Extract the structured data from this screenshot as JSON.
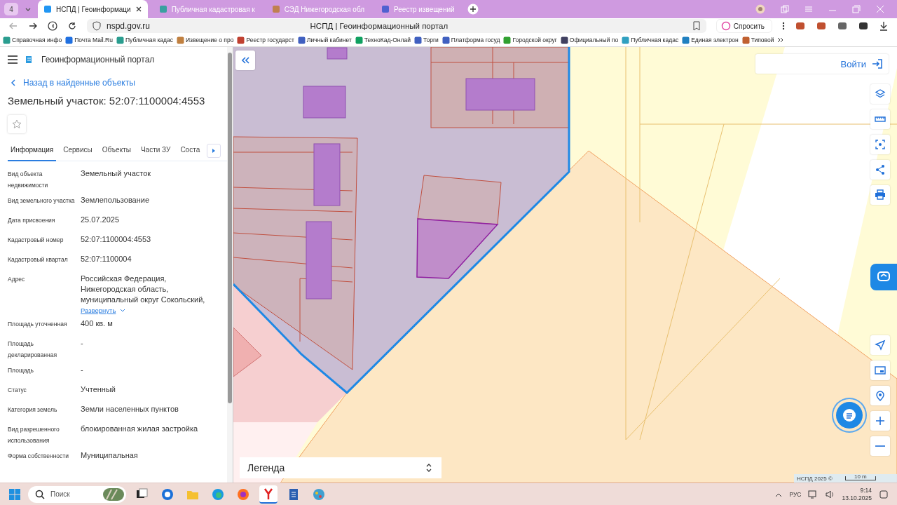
{
  "browser": {
    "tab_count": "4",
    "tabs": [
      {
        "label": "НСПД | Геоинформаци",
        "selected": true
      },
      {
        "label": "Публичная кадастровая к",
        "selected": false
      },
      {
        "label": "СЭД Нижегородская обл",
        "selected": false
      },
      {
        "label": "Реестр извещений",
        "selected": false
      }
    ],
    "address": "nspd.gov.ru",
    "page_title": "НСПД | Геоинформационный портал",
    "ask_button": "Спросить",
    "bookmarks": [
      "Справочная инфо",
      "Почта Mail.Ru",
      "Публичная кадас",
      "Извещение о про",
      "Реестр государст",
      "Личный кабинет",
      "ТехноКад-Онлай",
      "Торги",
      "Платформа госуд",
      "Городской округ",
      "Официальный по",
      "Публичная кадас",
      "Единая электрон",
      "Типовой"
    ]
  },
  "panel": {
    "portal_title": "Геоинформационный портал",
    "back_link": "Назад в найденные объекты",
    "heading": "Земельный участок: 52:07:1100004:4553",
    "tabs": [
      {
        "label": "Информация",
        "selected": true
      },
      {
        "label": "Сервисы",
        "selected": false
      },
      {
        "label": "Объекты",
        "selected": false
      },
      {
        "label": "Части ЗУ",
        "selected": false
      },
      {
        "label": "Соста",
        "selected": false
      }
    ],
    "fields": [
      {
        "label": "Вид объекта недвижимости",
        "value": "Земельный участок"
      },
      {
        "label": "Вид земельного участка",
        "value": "Землепользование"
      },
      {
        "label": "Дата присвоения",
        "value": "25.07.2025"
      },
      {
        "label": "Кадастровый номер",
        "value": "52:07:1100004:4553"
      },
      {
        "label": "Кадастровый квартал",
        "value": "52:07:1100004"
      },
      {
        "label": "Адрес",
        "value": "Российская Федерация, Нижегородская область, муниципальный округ Сокольский,",
        "expand_link": "Развернуть"
      },
      {
        "label": "Площадь уточненная",
        "value": "400 кв. м"
      },
      {
        "label": "Площадь декларированная",
        "value": "-"
      },
      {
        "label": "Площадь",
        "value": "-"
      },
      {
        "label": "Статус",
        "value": "Учтенный"
      },
      {
        "label": "Категория земель",
        "value": "Земли населенных пунктов"
      },
      {
        "label": "Вид разрешенного использования",
        "value": "блокированная жилая застройка"
      },
      {
        "label": "Форма собственности",
        "value": "Муниципальная"
      }
    ]
  },
  "map": {
    "login_button": "Войти",
    "legend": "Легенда",
    "attribution": "НСПД 2025 ©",
    "scale": "10 m"
  },
  "taskbar": {
    "search_placeholder": "Поиск",
    "language": "РУС",
    "time": "9:14",
    "date": "13.10.2025"
  }
}
